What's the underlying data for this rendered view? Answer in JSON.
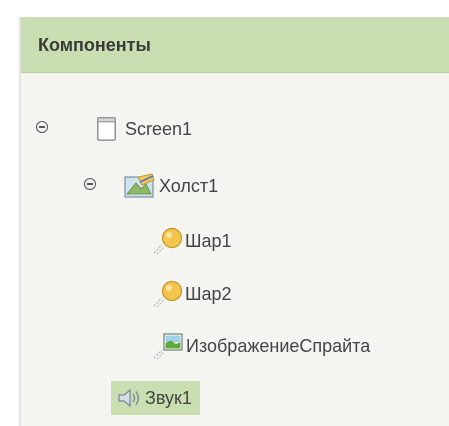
{
  "panel": {
    "title": "Компоненты"
  },
  "tree": {
    "screen": {
      "label": "Screen1",
      "icon": "screen-icon",
      "expanded": true
    },
    "canvas": {
      "label": "Холст1",
      "icon": "canvas-icon",
      "expanded": true
    },
    "ball1": {
      "label": "Шар1",
      "icon": "ball-icon"
    },
    "ball2": {
      "label": "Шар2",
      "icon": "ball-icon"
    },
    "sprite": {
      "label": "ИзображениеСпрайта",
      "icon": "image-sprite-icon"
    },
    "sound": {
      "label": "Звук1",
      "icon": "speaker-icon",
      "selected": true
    }
  },
  "colors": {
    "header_bg": "#c9deb1",
    "panel_bg": "#f4f5f1",
    "selected_bg": "#c9deb1",
    "text": "#444444"
  }
}
